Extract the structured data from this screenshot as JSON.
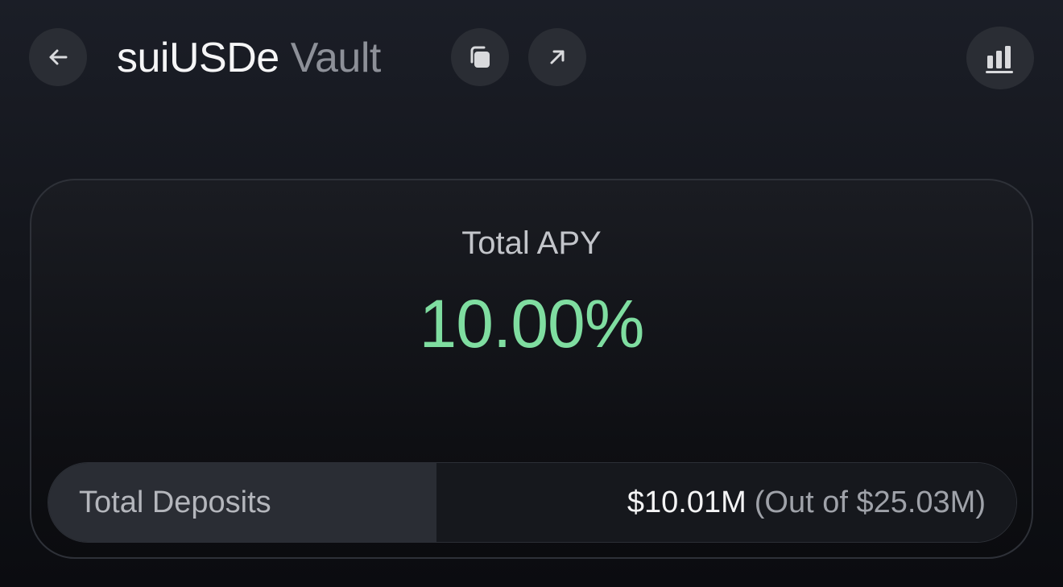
{
  "header": {
    "title_token": "suiUSDe",
    "title_suffix": "Vault",
    "back_icon": "arrow-left-icon",
    "copy_icon": "copy-icon",
    "external_icon": "arrow-up-right-icon",
    "stats_icon": "bar-chart-icon"
  },
  "apy": {
    "label": "Total APY",
    "value": "10.00%",
    "color": "#7fdda0"
  },
  "deposits": {
    "label": "Total Deposits",
    "value": "$10.01M",
    "cap": "(Out of $25.03M)"
  }
}
